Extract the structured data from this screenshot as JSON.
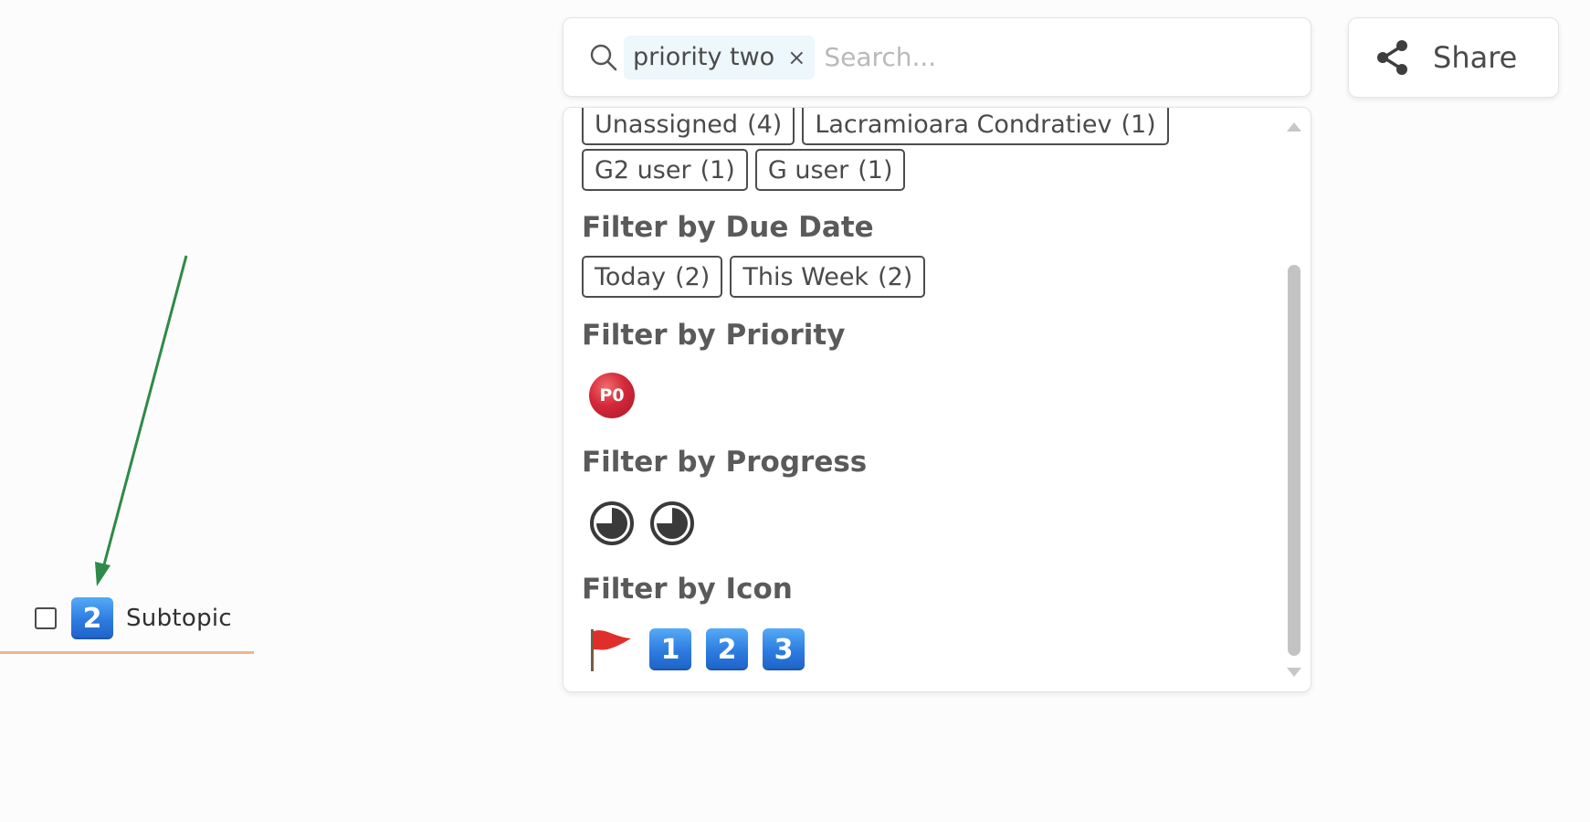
{
  "search": {
    "chip_label": "priority two",
    "chip_remove": "×",
    "placeholder": "Search...",
    "value": ""
  },
  "share": {
    "label": "Share",
    "icon": "share-icon"
  },
  "canvas": {
    "node": {
      "keycap": "2",
      "title": "Subtopic",
      "checked": false
    }
  },
  "filter_panel": {
    "assignees": [
      {
        "label": "Unassigned",
        "count": "(4)"
      },
      {
        "label": "Lacramioara Condratiev",
        "count": "(1)"
      },
      {
        "label": "G2 user",
        "count": "(1)"
      },
      {
        "label": "G user",
        "count": "(1)"
      }
    ],
    "due_date": {
      "title": "Filter by Due Date",
      "chips": [
        {
          "label": "Today",
          "count": "(2)"
        },
        {
          "label": "This Week",
          "count": "(2)"
        }
      ]
    },
    "priority": {
      "title": "Filter by Priority",
      "badges": [
        "P0"
      ]
    },
    "progress": {
      "title": "Filter by Progress",
      "icons": [
        "progress-icon",
        "progress-icon"
      ]
    },
    "icon": {
      "title": "Filter by Icon",
      "icons": [
        "flag-icon",
        "1",
        "2",
        "3"
      ]
    }
  },
  "colors": {
    "accent_blue": "#2d7be0",
    "arrow_green": "#2e8a48",
    "underline_orange": "#f0b48d",
    "priority_red": "#d4283a"
  }
}
